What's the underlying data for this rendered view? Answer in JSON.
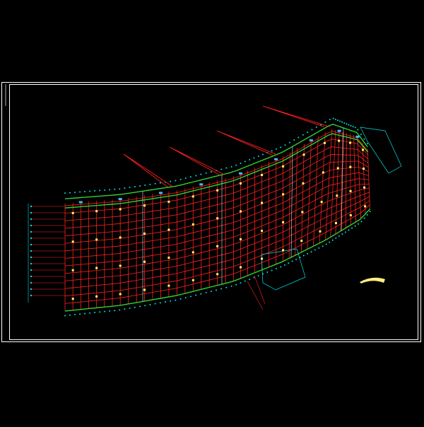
{
  "drawing": {
    "colors": {
      "background": "#000000",
      "frame": "#ffffff",
      "grid": "#ff2020",
      "wall": "#30d030",
      "dimension": "#00e0e0",
      "column": "#ffff60",
      "furniture": "#40c0ff"
    },
    "legend": {
      "title": "",
      "lines": []
    }
  }
}
